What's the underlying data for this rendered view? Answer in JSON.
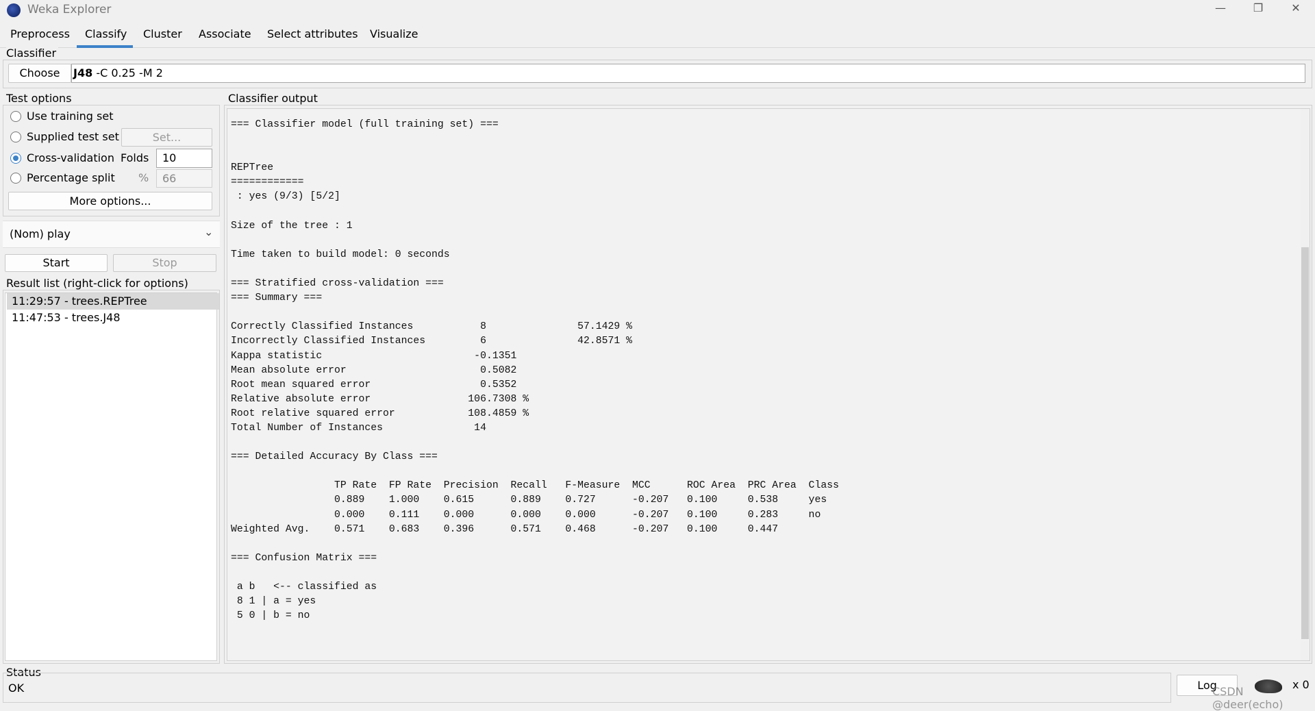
{
  "window": {
    "title": "Weka Explorer",
    "minimize": "—",
    "restore": "❐",
    "close": "✕"
  },
  "tabs": [
    {
      "label": "Preprocess"
    },
    {
      "label": "Classify",
      "active": true
    },
    {
      "label": "Cluster"
    },
    {
      "label": "Associate"
    },
    {
      "label": "Select attributes"
    },
    {
      "label": "Visualize"
    }
  ],
  "classifier": {
    "label": "Classifier",
    "choose": "Choose",
    "name": "J48",
    "options": "-C 0.25 -M 2"
  },
  "test_options": {
    "label": "Test options",
    "use_training": "Use training set",
    "supplied": "Supplied test set",
    "set_button": "Set...",
    "cross_validation": "Cross-validation",
    "folds_label": "Folds",
    "folds_value": "10",
    "percentage": "Percentage split",
    "percent_sign": "%",
    "percent_value": "66",
    "more_options": "More options...",
    "selected": "Cross-validation"
  },
  "class_attribute": "(Nom) play",
  "start": "Start",
  "stop": "Stop",
  "result_list": {
    "label": "Result list (right-click for options)",
    "items": [
      "11:29:57 - trees.REPTree",
      "11:47:53 - trees.J48"
    ],
    "selected_index": 0
  },
  "output": {
    "label": "Classifier output",
    "lines": [
      "=== Classifier model (full training set) ===",
      "",
      "",
      "REPTree",
      "============",
      " : yes (9/3) [5/2]",
      "",
      "Size of the tree : 1",
      "",
      "Time taken to build model: 0 seconds",
      "",
      "=== Stratified cross-validation ===",
      "=== Summary ===",
      "",
      "Correctly Classified Instances           8               57.1429 %",
      "Incorrectly Classified Instances         6               42.8571 %",
      "Kappa statistic                         -0.1351",
      "Mean absolute error                      0.5082",
      "Root mean squared error                  0.5352",
      "Relative absolute error                106.7308 %",
      "Root relative squared error            108.4859 %",
      "Total Number of Instances               14",
      "",
      "=== Detailed Accuracy By Class ===",
      "",
      "                 TP Rate  FP Rate  Precision  Recall   F-Measure  MCC      ROC Area  PRC Area  Class",
      "                 0.889    1.000    0.615      0.889    0.727      -0.207   0.100     0.538     yes",
      "                 0.000    0.111    0.000      0.000    0.000      -0.207   0.100     0.283     no",
      "Weighted Avg.    0.571    0.683    0.396      0.571    0.468      -0.207   0.100     0.447",
      "",
      "=== Confusion Matrix ===",
      "",
      " a b   <-- classified as",
      " 8 1 | a = yes",
      " 5 0 | b = no"
    ]
  },
  "status": {
    "label": "Status",
    "text": "OK",
    "log": "Log",
    "count": "x 0",
    "watermark": "CSDN @deer(echo)"
  },
  "colors": {
    "accent": "#3c82c8",
    "background": "#f0f0f0"
  }
}
